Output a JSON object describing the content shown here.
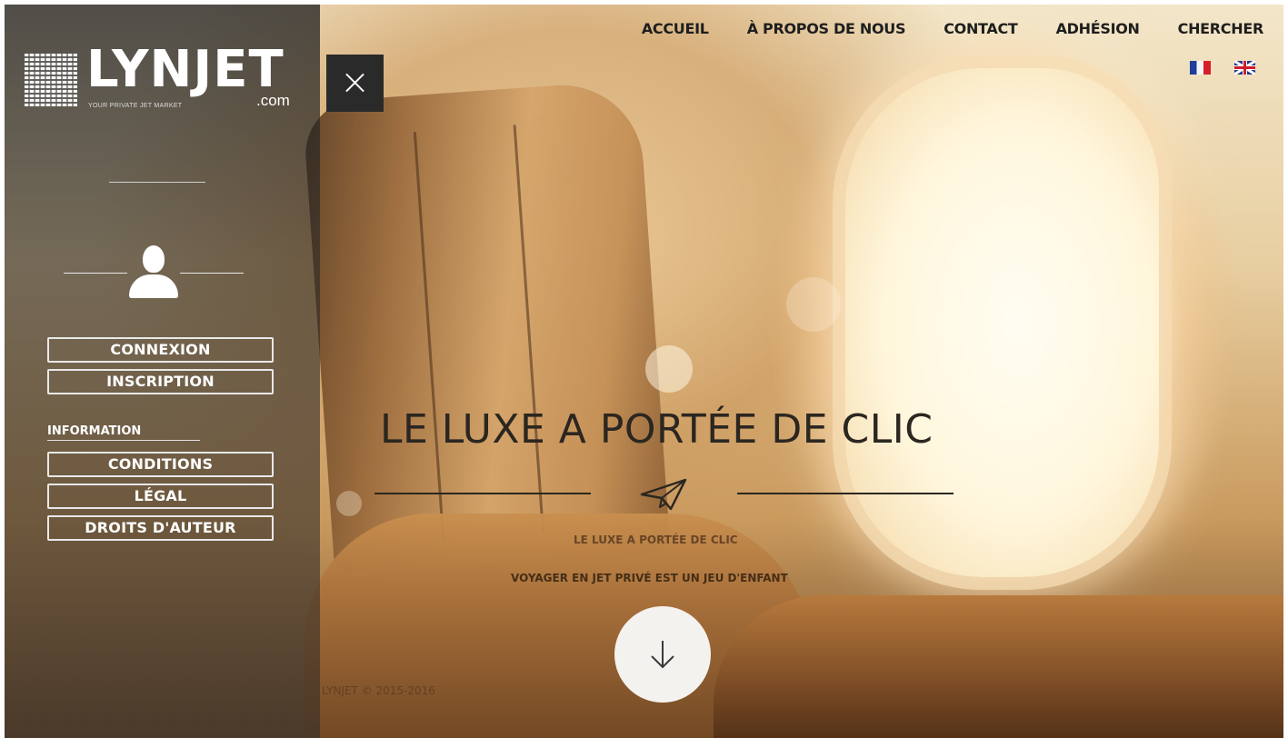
{
  "brand": {
    "name": "LYNJET",
    "domain_suffix": ".com",
    "tagline": "YOUR PRIVATE JET MARKET"
  },
  "nav": {
    "items": [
      {
        "label": "ACCUEIL"
      },
      {
        "label": "À PROPOS DE NOUS"
      },
      {
        "label": "CONTACT"
      },
      {
        "label": "ADHÉSION"
      },
      {
        "label": "CHERCHER"
      }
    ],
    "languages": [
      {
        "code": "fr",
        "icon": "france-flag-icon"
      },
      {
        "code": "en",
        "icon": "uk-flag-icon"
      }
    ]
  },
  "sidebar": {
    "account_buttons": [
      {
        "label": "CONNEXION"
      },
      {
        "label": "INSCRIPTION"
      }
    ],
    "info_heading": "INFORMATION",
    "info_buttons": [
      {
        "label": "CONDITIONS"
      },
      {
        "label": "LÉGAL"
      },
      {
        "label": "DROITS D'AUTEUR"
      }
    ]
  },
  "hero": {
    "title": "LE LUXE A PORTÉE DE CLIC",
    "subtitle_1": "LE LUXE A PORTÉE DE CLIC",
    "subtitle_2": "VOYAGER EN JET PRIVÉ EST UN JEU D'ENFANT"
  },
  "footer": {
    "copyright": "LYNJET © 2015-2016"
  },
  "colors": {
    "sidebar_overlay": "#2a2a2a",
    "text_dark": "#1e1e1e",
    "hero_text": "#2b2620"
  }
}
